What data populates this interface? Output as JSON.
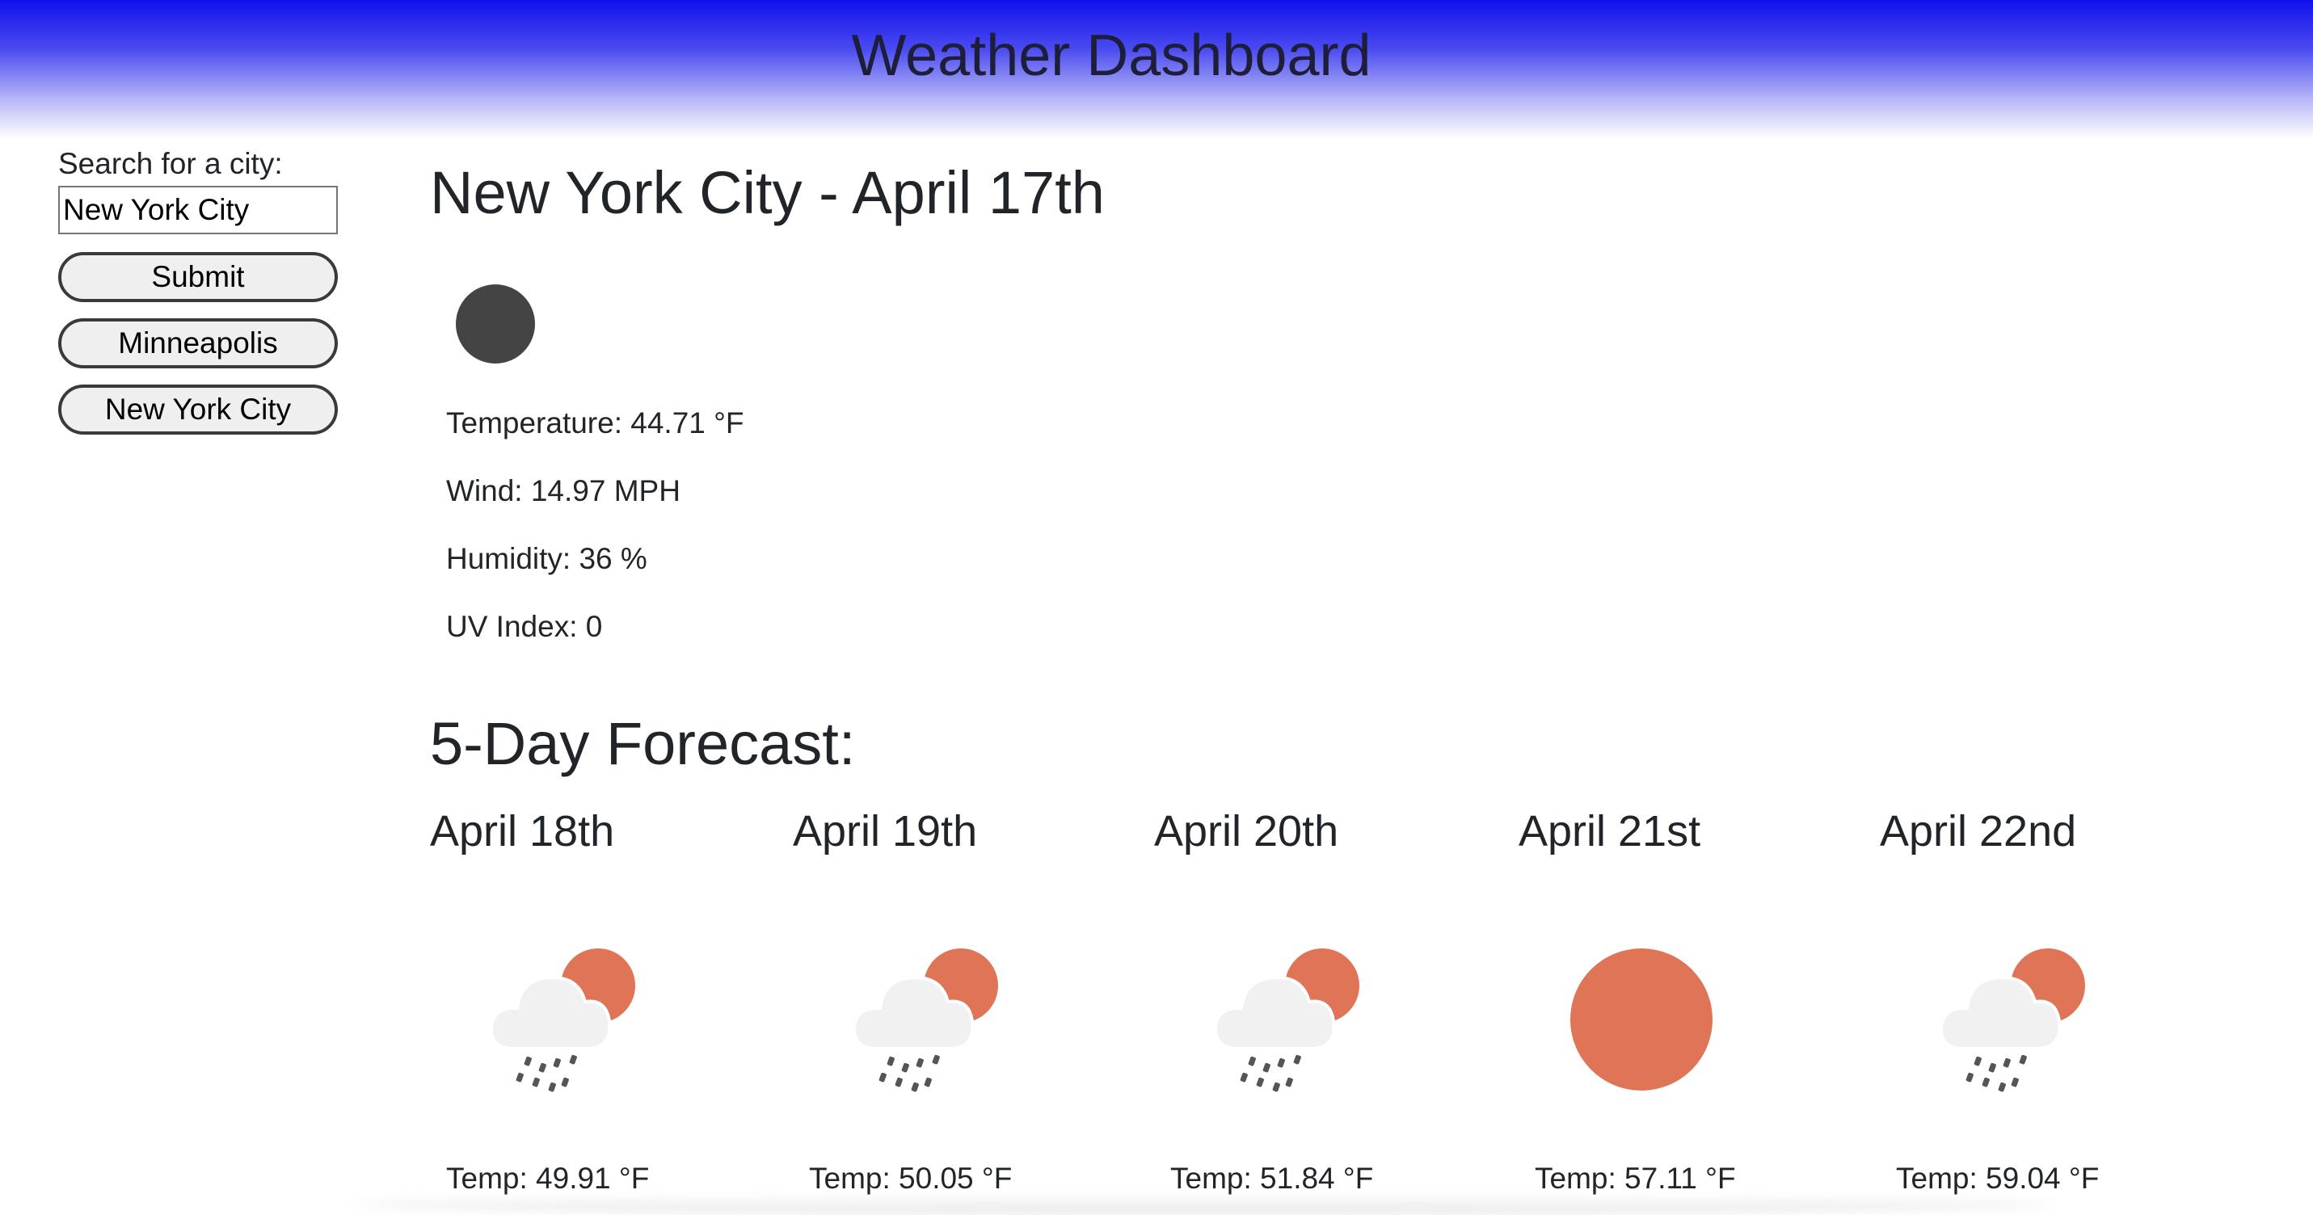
{
  "header": {
    "title": "Weather Dashboard"
  },
  "search": {
    "label": "Search for a city:",
    "value": "New York City",
    "submit_label": "Submit",
    "history": [
      "Minneapolis",
      "New York City"
    ]
  },
  "current": {
    "title": "New York City - April 17th",
    "icon": "dark-circle-icon",
    "temperature": "Temperature: 44.71 °F",
    "wind": "Wind: 14.97 MPH",
    "humidity": "Humidity: 36 %",
    "uv_index": "UV Index: 0"
  },
  "forecast": {
    "title": "5-Day Forecast:",
    "days": [
      {
        "date": "April 18th",
        "icon": "cloud-sun-rain-icon",
        "temp": "Temp: 49.91 °F"
      },
      {
        "date": "April 19th",
        "icon": "cloud-sun-rain-icon",
        "temp": "Temp: 50.05 °F"
      },
      {
        "date": "April 20th",
        "icon": "cloud-sun-rain-icon",
        "temp": "Temp: 51.84 °F"
      },
      {
        "date": "April 21st",
        "icon": "sun-icon",
        "temp": "Temp: 57.11 °F"
      },
      {
        "date": "April 22nd",
        "icon": "cloud-sun-rain-icon",
        "temp": "Temp: 59.04 °F"
      }
    ]
  },
  "colors": {
    "header_top": "#1010ee",
    "sun": "#e07456",
    "cloud": "#f1f1f1",
    "rain": "#555555",
    "moon": "#444444"
  }
}
